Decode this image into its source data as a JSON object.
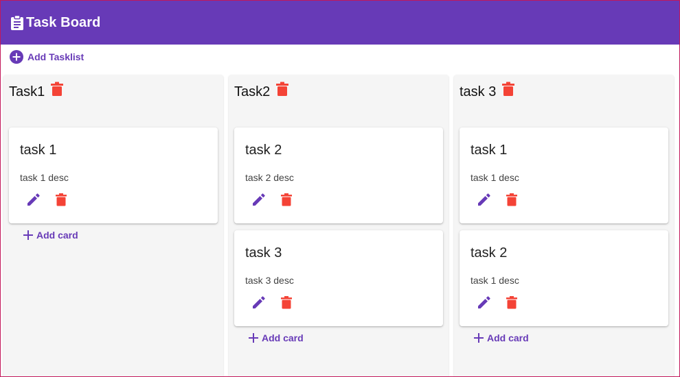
{
  "app": {
    "title": "Task Board",
    "colors": {
      "primary": "#673ab7",
      "danger": "#f44336"
    }
  },
  "toolbar": {
    "add_tasklist_label": "Add Tasklist"
  },
  "columns": [
    {
      "title": "Task1",
      "cards": [
        {
          "title": "task 1",
          "desc": "task 1 desc"
        }
      ],
      "add_card_label": "Add card"
    },
    {
      "title": "Task2",
      "cards": [
        {
          "title": "task 2",
          "desc": "task 2 desc"
        },
        {
          "title": "task 3",
          "desc": "task 3 desc"
        }
      ],
      "add_card_label": "Add card"
    },
    {
      "title": "task 3",
      "cards": [
        {
          "title": "task 1",
          "desc": "task 1 desc"
        },
        {
          "title": "task 2",
          "desc": "task 1 desc"
        }
      ],
      "add_card_label": "Add card"
    }
  ],
  "icons": {
    "app": "clipboard-icon",
    "add_tasklist": "add-circle-icon",
    "delete": "trash-icon",
    "edit": "pencil-icon",
    "add_card": "plus-icon"
  }
}
